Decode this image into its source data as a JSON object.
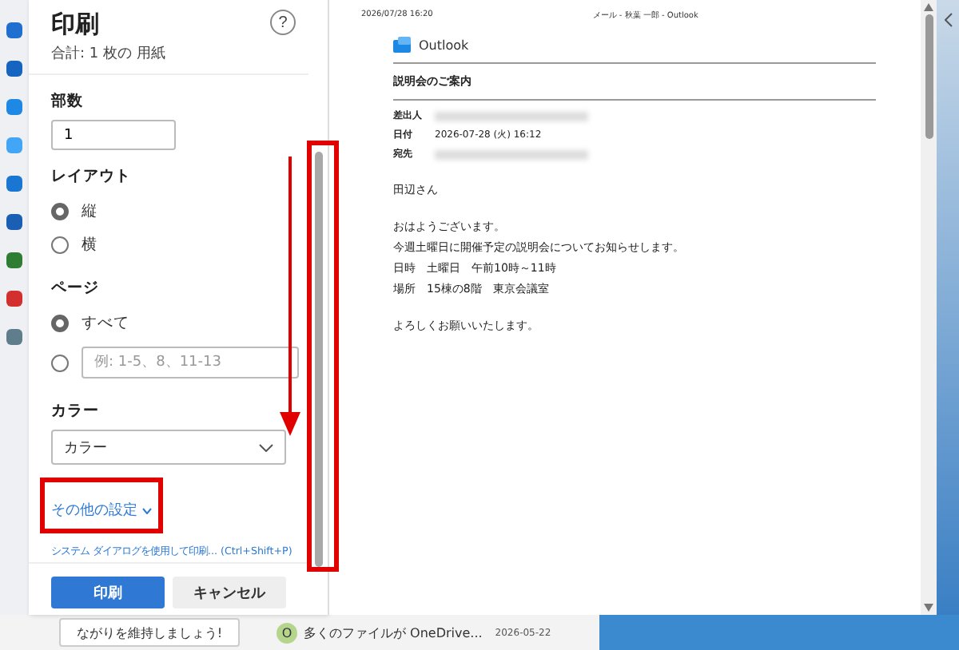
{
  "rail": {
    "icons": [
      {
        "color": "#1f6fd1"
      },
      {
        "color": "#1565c0"
      },
      {
        "color": "#1e88e5"
      },
      {
        "color": "#42a5f5"
      },
      {
        "color": "#1976d2"
      },
      {
        "color": "#1a5fb4"
      },
      {
        "color": "#2e7d32"
      },
      {
        "color": "#d32f2f"
      },
      {
        "color": "#607d8b"
      }
    ]
  },
  "print_panel": {
    "title": "印刷",
    "subtitle": "合計: 1 枚の 用紙",
    "help": "?",
    "copies": {
      "label": "部数",
      "value": "1"
    },
    "layout": {
      "label": "レイアウト",
      "options": [
        {
          "label": "縦",
          "selected": true
        },
        {
          "label": "横",
          "selected": false
        }
      ]
    },
    "pages": {
      "label": "ページ",
      "options": [
        {
          "kind": "label",
          "label": "すべて",
          "selected": true
        },
        {
          "kind": "input",
          "placeholder": "例: 1-5、8、11-13",
          "selected": false
        }
      ]
    },
    "color": {
      "label": "カラー",
      "value": "カラー"
    },
    "more_settings": "その他の設定",
    "system_dialog": "システム ダイアログを使用して印刷... (Ctrl+Shift+P)",
    "buttons": [
      {
        "kind": "primary",
        "label": "印刷"
      },
      {
        "kind": "secondary",
        "label": "キャンセル"
      }
    ]
  },
  "preview": {
    "header_left": "2026/07/28 16:20",
    "header_center": "メール - 秋葉 一郎 - Outlook",
    "brand": "Outlook",
    "subject": "説明会のご案内",
    "fields": [
      {
        "label": "差出人",
        "kind": "hidden"
      },
      {
        "label": "日付",
        "kind": "text",
        "value": "2026-07-28 (火) 16:12"
      },
      {
        "label": "宛先",
        "kind": "hidden"
      }
    ],
    "paragraphs": [
      [
        "田辺さん"
      ],
      [
        "おはようございます。",
        "今週土曜日に開催予定の説明会についてお知らせします。",
        "日時　土曜日　午前10時～11時",
        "場所　15棟の8階　東京会議室"
      ],
      [
        "よろしくお願いいたします。"
      ]
    ]
  },
  "background_list": {
    "button": "ながりを維持しましょう!",
    "avatar": "O",
    "preview": "多くのファイルが OneDrive...",
    "date": "2026-05-22"
  }
}
